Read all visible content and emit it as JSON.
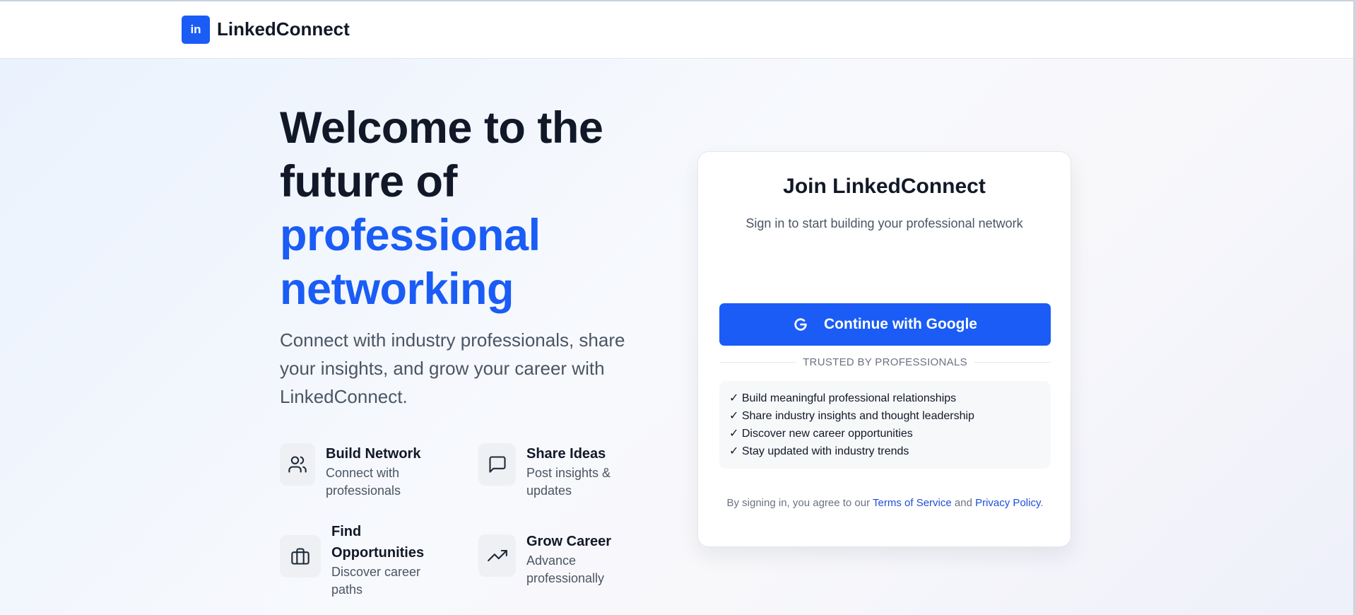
{
  "header": {
    "logo_text": "in",
    "brand": "LinkedConnect"
  },
  "hero": {
    "title_line1": "Welcome to the",
    "title_line2": "future of",
    "title_accent1": "professional",
    "title_accent2": "networking",
    "subtitle": "Connect with industry professionals, share your insights, and grow your career with LinkedConnect."
  },
  "features": [
    {
      "title": "Build Network",
      "desc": "Connect with professionals",
      "icon": "users-icon"
    },
    {
      "title": "Share Ideas",
      "desc": "Post insights & updates",
      "icon": "message-square-icon"
    },
    {
      "title": "Find Opportunities",
      "desc": "Discover career paths",
      "icon": "briefcase-icon"
    },
    {
      "title": "Grow Career",
      "desc": "Advance professionally",
      "icon": "trending-up-icon"
    }
  ],
  "card": {
    "title": "Join LinkedConnect",
    "subtitle": "Sign in to start building your professional network",
    "google_button": "Continue with Google",
    "divider": "TRUSTED BY PROFESSIONALS",
    "benefits": [
      "✓ Build meaningful professional relationships",
      "✓ Share industry insights and thought leadership",
      "✓ Discover new career opportunities",
      "✓ Stay updated with industry trends"
    ],
    "terms_prefix": "By signing in, you agree to our",
    "terms_link": "Terms of Service",
    "terms_and": "and",
    "privacy_link": "Privacy Policy",
    "terms_suffix": "."
  },
  "colors": {
    "accent": "#1a5cf5",
    "text_dark": "#111827",
    "text_muted": "#4b5563",
    "link": "#1d4ed8"
  }
}
